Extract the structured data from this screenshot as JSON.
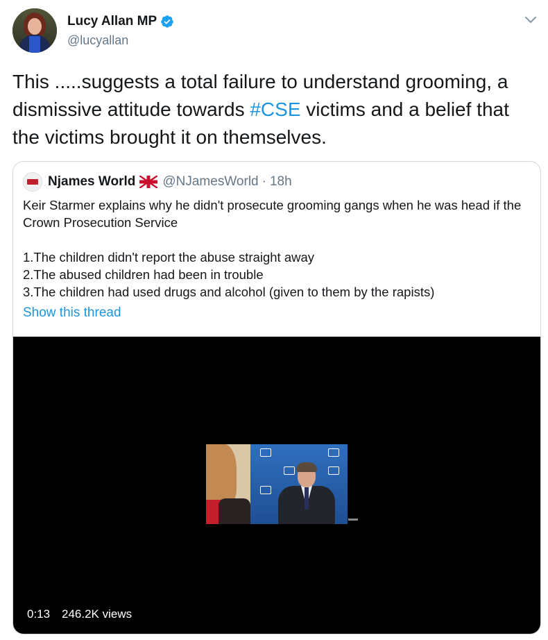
{
  "author": {
    "display_name": "Lucy Allan MP",
    "handle": "@lucyallan",
    "verified_icon": "verified-badge-icon"
  },
  "tweet": {
    "text_before": "This .....suggests a total failure to understand grooming, a dismissive attitude towards ",
    "hashtag": "#CSE",
    "text_after": " victims and a belief that the victims brought it on themselves."
  },
  "quoted": {
    "display_name": "Njames World",
    "flag_icon": "uk-flag-icon",
    "handle": "@NJamesWorld",
    "separator": "·",
    "time": "18h",
    "body_line1": "Keir Starmer explains why he didn't prosecute grooming gangs when he was head if the Crown Prosecution Service",
    "list": [
      "1.The children didn't report the abuse straight away",
      "2.The abused children had been in trouble",
      "3.The children had used drugs and alcohol (given to them by the rapists)"
    ],
    "show_thread": "Show this thread",
    "video": {
      "time": "0:13",
      "views": "246.2K views"
    }
  },
  "colors": {
    "link": "#1b95e0",
    "text": "#14171a",
    "secondary": "#657786",
    "border": "#cfd9de"
  }
}
